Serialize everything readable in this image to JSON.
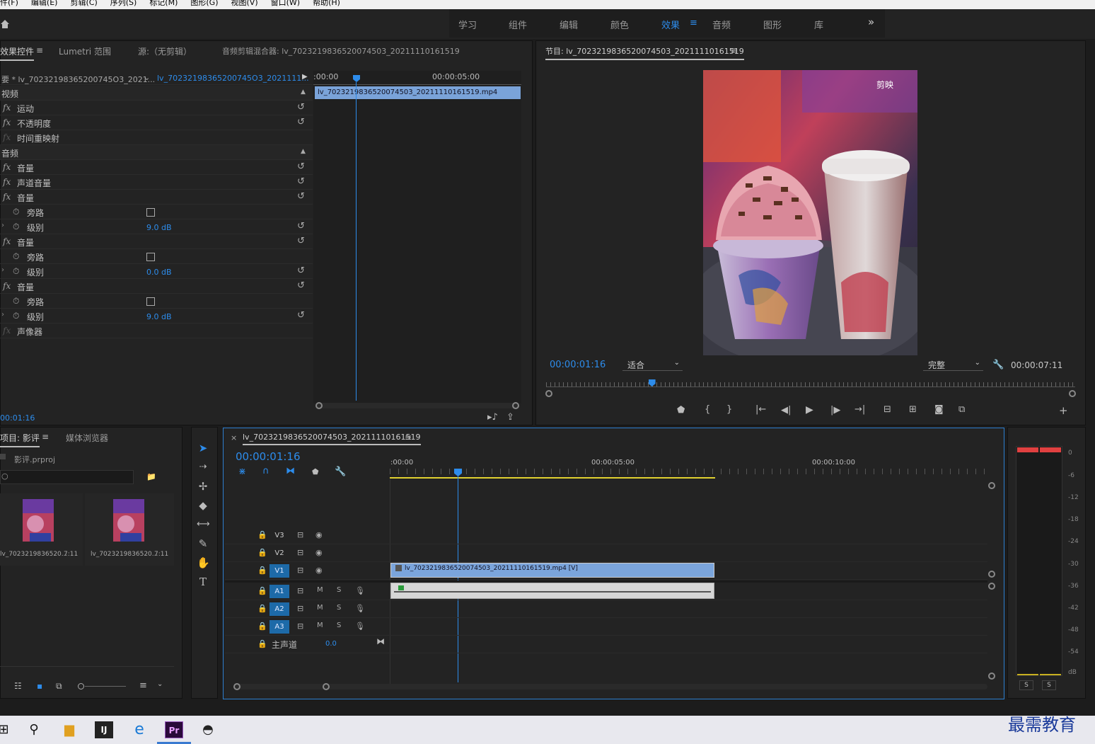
{
  "menu": [
    "件(F)",
    "编辑(E)",
    "剪辑(C)",
    "序列(S)",
    "标记(M)",
    "图形(G)",
    "视图(V)",
    "窗口(W)",
    "帮助(H)"
  ],
  "workspaces": [
    "学习",
    "组件",
    "编辑",
    "颜色",
    "效果",
    "音频",
    "图形",
    "库"
  ],
  "workspace_active": "效果",
  "workspace_more": "»",
  "effects_panel": {
    "tabs": [
      "效果控件",
      "Lumetri 范围",
      "源:（无剪辑）",
      "音频剪辑混合器: lv_7023219836520074503_20211110161519"
    ],
    "master_clip": "要 * lv_70232198365200745O3_2021...",
    "sequence_clip": "lv_70232198365200745O3_2021111...",
    "ruler_start": ":00:00",
    "ruler_mid": "00:00:05:00",
    "clip_name": "lv_7023219836520074503_20211110161519.mp4",
    "timecode": "00:01:16",
    "rows": [
      {
        "kind": "section",
        "label": "视频"
      },
      {
        "kind": "fx",
        "label": "运动"
      },
      {
        "kind": "fx",
        "label": "不透明度"
      },
      {
        "kind": "fx",
        "label": "时间重映射"
      },
      {
        "kind": "section",
        "label": "音频"
      },
      {
        "kind": "fx",
        "label": "音量"
      },
      {
        "kind": "fx",
        "label": "声道音量"
      },
      {
        "kind": "fx",
        "label": "音量"
      },
      {
        "kind": "bypass",
        "label": "旁路"
      },
      {
        "kind": "level",
        "label": "级别",
        "value": "9.0 dB"
      },
      {
        "kind": "fx",
        "label": "音量"
      },
      {
        "kind": "bypass",
        "label": "旁路"
      },
      {
        "kind": "level",
        "label": "级别",
        "value": "0.0 dB"
      },
      {
        "kind": "fx",
        "label": "音量"
      },
      {
        "kind": "bypass",
        "label": "旁路"
      },
      {
        "kind": "level",
        "label": "级别",
        "value": "9.0 dB"
      },
      {
        "kind": "fx",
        "label": "声像器"
      }
    ]
  },
  "program": {
    "title": "节目: lv_7023219836520074503_20211110161519",
    "timecode": "00:00:01:16",
    "fit": "适合",
    "quality": "完整",
    "duration": "00:00:07:11",
    "watermark": "剪映",
    "playhead_fraction": 0.2
  },
  "project": {
    "tabs": [
      "项目: 影评",
      "媒体浏览器"
    ],
    "file": "影评.prproj",
    "items": [
      {
        "name": "lv_7023219836520...",
        "dur": "7:11"
      },
      {
        "name": "lv_7023219836520...",
        "dur": "7:11"
      }
    ]
  },
  "timeline": {
    "title": "lv_7023219836520074503_20211110161519",
    "close": "×",
    "timecode": "00:00:01:16",
    "ruler": [
      ":00:00",
      "00:00:05:00",
      "00:00:10:00"
    ],
    "video_clip": "lv_7023219836520074503_20211110161519.mp4 [V]",
    "video_tracks": [
      "V3",
      "V2",
      "V1"
    ],
    "audio_tracks": [
      "A1",
      "A2",
      "A3"
    ],
    "mute": "M",
    "solo": "S",
    "master_label": "主声道",
    "master_value": "0.0"
  },
  "meter": {
    "scale": [
      "0",
      "-6",
      "-12",
      "-18",
      "-24",
      "-30",
      "-36",
      "-42",
      "-48",
      "-54",
      "dB"
    ],
    "solo_left": "S",
    "solo_right": "S"
  },
  "brand": "最需教育"
}
